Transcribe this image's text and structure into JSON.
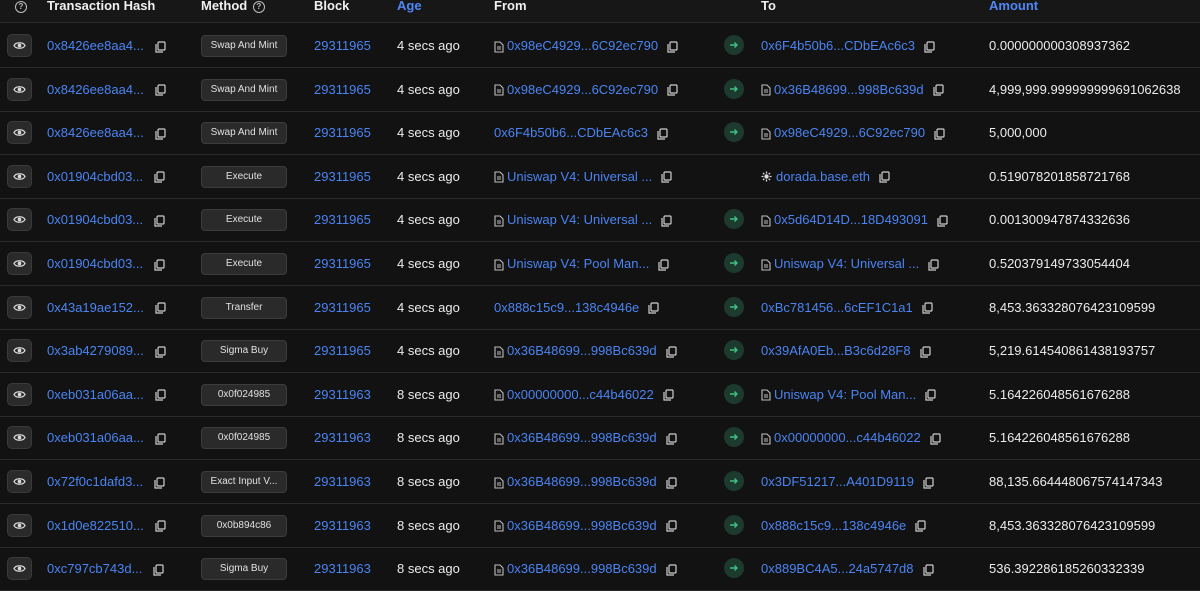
{
  "header": {
    "hash": "Transaction Hash",
    "method": "Method",
    "block": "Block",
    "age": "Age",
    "from": "From",
    "to": "To",
    "amount": "Amount"
  },
  "rows": [
    {
      "hash": "0x8426ee8aa4...",
      "method": "Swap And Mint",
      "block": "29311965",
      "age": "4 secs ago",
      "from": "0x98eC4929...6C92ec790",
      "from_doc": true,
      "to": "0x6F4b50b6...CDbEAc6c3",
      "to_doc": false,
      "amount": "0.000000000308937362",
      "arrow": true
    },
    {
      "hash": "0x8426ee8aa4...",
      "method": "Swap And Mint",
      "block": "29311965",
      "age": "4 secs ago",
      "from": "0x98eC4929...6C92ec790",
      "from_doc": true,
      "to": "0x36B48699...998Bc639d",
      "to_doc": true,
      "amount": "4,999,999.999999999691062638",
      "arrow": true
    },
    {
      "hash": "0x8426ee8aa4...",
      "method": "Swap And Mint",
      "block": "29311965",
      "age": "4 secs ago",
      "from": "0x6F4b50b6...CDbEAc6c3",
      "from_doc": false,
      "to": "0x98eC4929...6C92ec790",
      "to_doc": true,
      "amount": "5,000,000",
      "arrow": true
    },
    {
      "hash": "0x01904cbd03...",
      "method": "Execute",
      "block": "29311965",
      "age": "4 secs ago",
      "from": "Uniswap V4: Universal ...",
      "from_doc": true,
      "to": "dorada.base.eth",
      "to_doc": false,
      "to_star": true,
      "amount": "0.519078201858721768",
      "arrow": false
    },
    {
      "hash": "0x01904cbd03...",
      "method": "Execute",
      "block": "29311965",
      "age": "4 secs ago",
      "from": "Uniswap V4: Universal ...",
      "from_doc": true,
      "to": "0x5d64D14D...18D493091",
      "to_doc": true,
      "amount": "0.001300947874332636",
      "arrow": true
    },
    {
      "hash": "0x01904cbd03...",
      "method": "Execute",
      "block": "29311965",
      "age": "4 secs ago",
      "from": "Uniswap V4: Pool Man...",
      "from_doc": true,
      "to": "Uniswap V4: Universal ...",
      "to_doc": true,
      "amount": "0.520379149733054404",
      "arrow": true
    },
    {
      "hash": "0x43a19ae152...",
      "method": "Transfer",
      "block": "29311965",
      "age": "4 secs ago",
      "from": "0x888c15c9...138c4946e",
      "from_doc": false,
      "to": "0xBc781456...6cEF1C1a1",
      "to_doc": false,
      "amount": "8,453.363328076423109599",
      "arrow": true
    },
    {
      "hash": "0x3ab4279089...",
      "method": "Sigma Buy",
      "block": "29311965",
      "age": "4 secs ago",
      "from": "0x36B48699...998Bc639d",
      "from_doc": true,
      "to": "0x39AfA0Eb...B3c6d28F8",
      "to_doc": false,
      "amount": "5,219.614540861438193757",
      "arrow": true
    },
    {
      "hash": "0xeb031a06aa...",
      "method": "0x0f024985",
      "block": "29311963",
      "age": "8 secs ago",
      "from": "0x00000000...c44b46022",
      "from_doc": true,
      "to": "Uniswap V4: Pool Man...",
      "to_doc": true,
      "amount": "5.164226048561676288",
      "arrow": true
    },
    {
      "hash": "0xeb031a06aa...",
      "method": "0x0f024985",
      "block": "29311963",
      "age": "8 secs ago",
      "from": "0x36B48699...998Bc639d",
      "from_doc": true,
      "to": "0x00000000...c44b46022",
      "to_doc": true,
      "amount": "5.164226048561676288",
      "arrow": true
    },
    {
      "hash": "0x72f0c1dafd3...",
      "method": "Exact Input V...",
      "block": "29311963",
      "age": "8 secs ago",
      "from": "0x36B48699...998Bc639d",
      "from_doc": true,
      "to": "0x3DF51217...A401D9119",
      "to_doc": false,
      "amount": "88,135.664448067574147343",
      "arrow": true
    },
    {
      "hash": "0x1d0e822510...",
      "method": "0x0b894c86",
      "block": "29311963",
      "age": "8 secs ago",
      "from": "0x36B48699...998Bc639d",
      "from_doc": true,
      "to": "0x888c15c9...138c4946e",
      "to_doc": false,
      "amount": "8,453.363328076423109599",
      "arrow": true
    },
    {
      "hash": "0xc797cb743d...",
      "method": "Sigma Buy",
      "block": "29311963",
      "age": "8 secs ago",
      "from": "0x36B48699...998Bc639d",
      "from_doc": true,
      "to": "0x889BC4A5...24a5747d8",
      "to_doc": false,
      "amount": "536.392286185260332339",
      "arrow": true
    }
  ],
  "colors": {
    "link": "#4a84f3",
    "background": "#121212",
    "arrow_bg": "#1d3a2f",
    "arrow_fg": "#3fbf86"
  },
  "icons": {
    "view": "eye-icon",
    "copy": "copy-icon",
    "contract": "document-icon",
    "direction": "arrow-right-icon",
    "info": "question-circle-icon"
  }
}
